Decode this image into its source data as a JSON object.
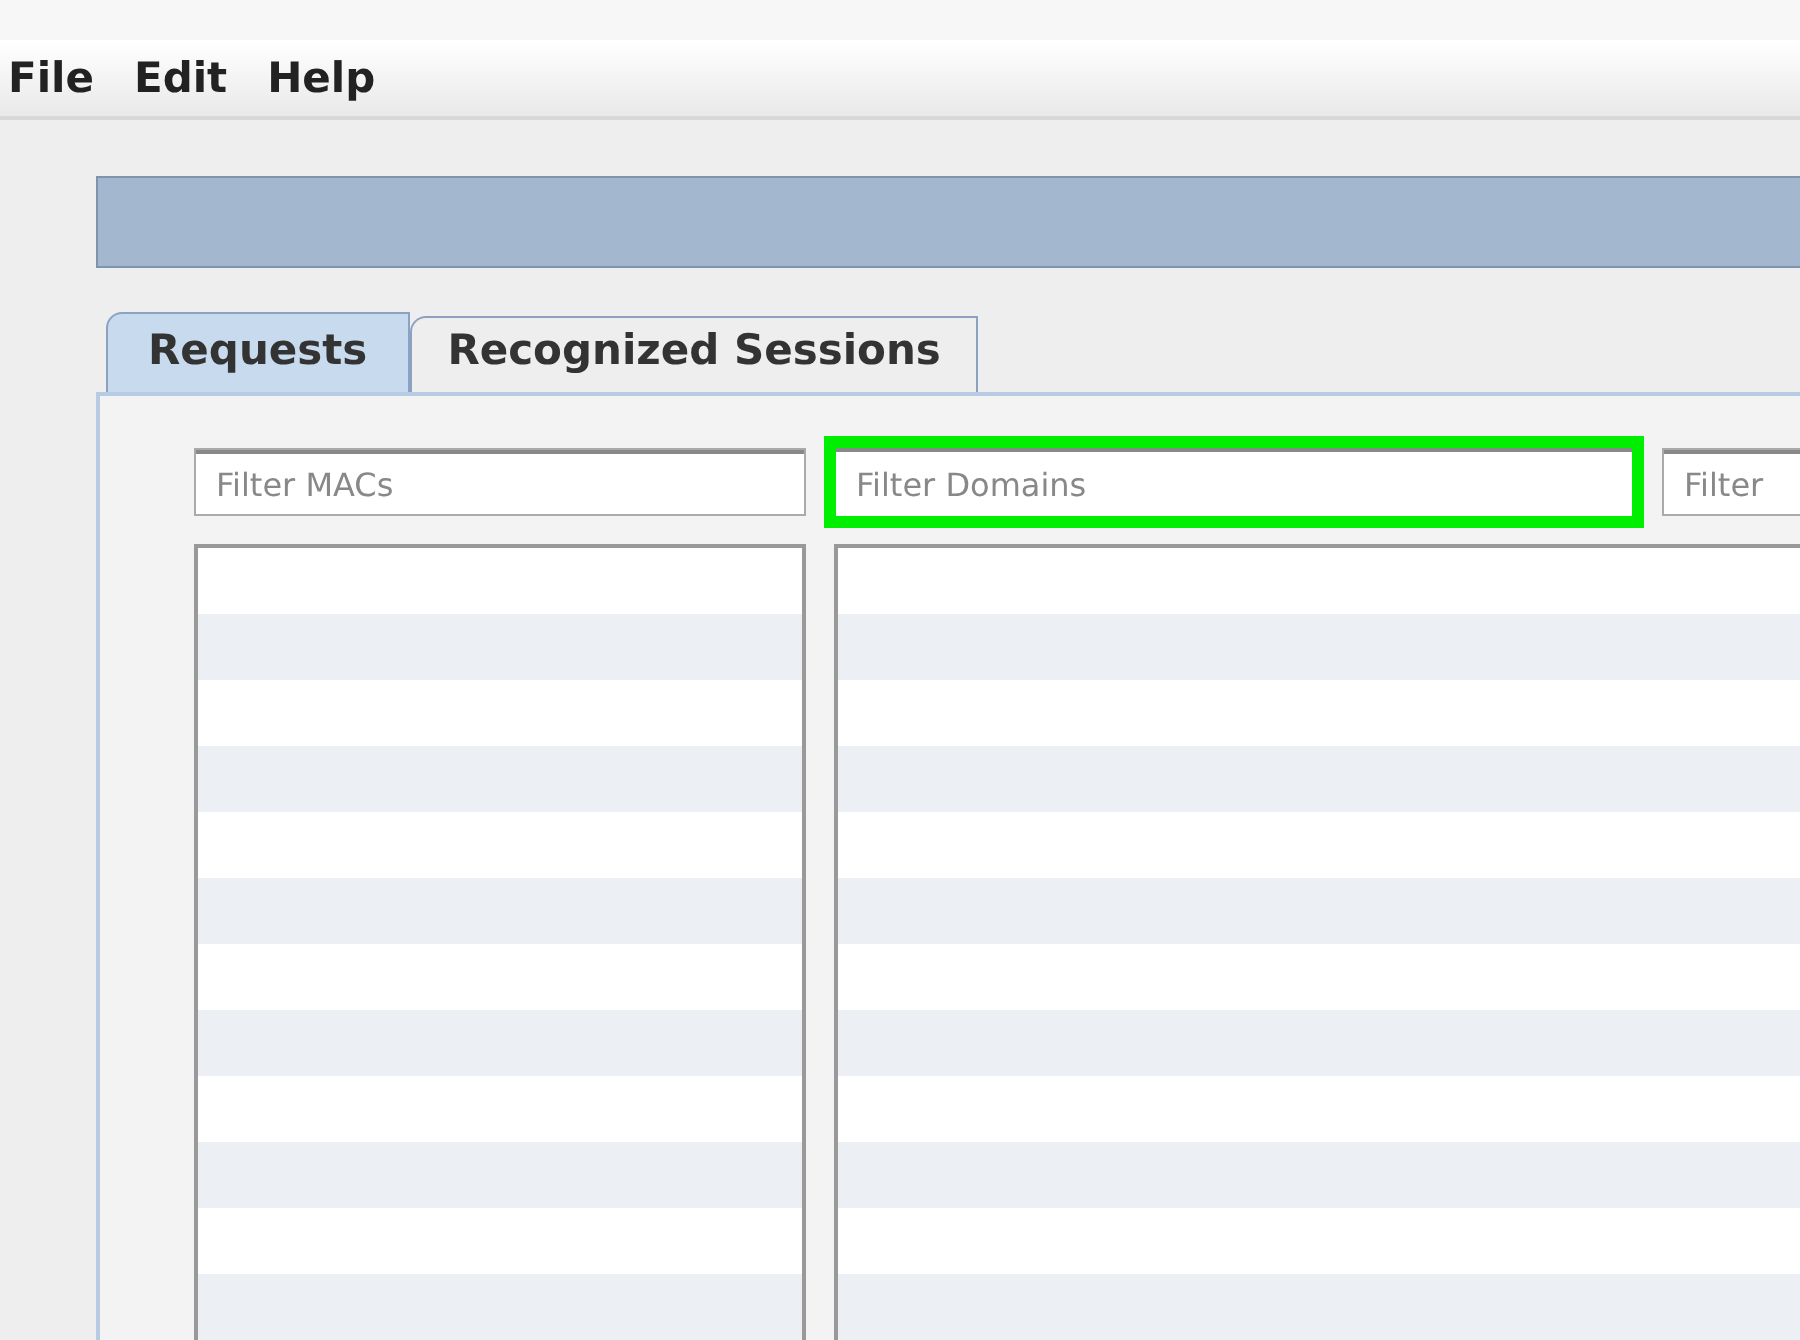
{
  "menu": [
    "File",
    "Edit",
    "Help"
  ],
  "tabs": [
    {
      "label": "Requests",
      "selected": true
    },
    {
      "label": "Recognized Sessions",
      "selected": false
    }
  ],
  "filters": [
    {
      "placeholder": "Filter MACs",
      "highlighted": false
    },
    {
      "placeholder": "Filter Domains",
      "highlighted": true
    },
    {
      "placeholder": "Filter",
      "highlighted": false
    }
  ]
}
